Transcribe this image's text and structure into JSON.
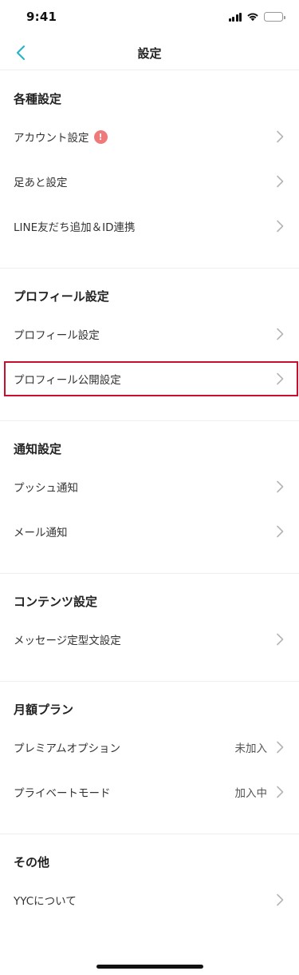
{
  "status": {
    "time": "9:41"
  },
  "nav": {
    "title": "設定"
  },
  "sections": [
    {
      "title": "各種設定",
      "items": [
        {
          "label": "アカウント設定",
          "alert": "!"
        },
        {
          "label": "足あと設定"
        },
        {
          "label": "LINE友だち追加＆ID連携"
        }
      ]
    },
    {
      "title": "プロフィール設定",
      "items": [
        {
          "label": "プロフィール設定"
        },
        {
          "label": "プロフィール公開設定"
        }
      ]
    },
    {
      "title": "通知設定",
      "items": [
        {
          "label": "プッシュ通知"
        },
        {
          "label": "メール通知"
        }
      ]
    },
    {
      "title": "コンテンツ設定",
      "items": [
        {
          "label": "メッセージ定型文設定"
        }
      ]
    },
    {
      "title": "月額プラン",
      "items": [
        {
          "label": "プレミアムオプション",
          "value": "未加入"
        },
        {
          "label": "プライベートモード",
          "value": "加入中"
        }
      ]
    },
    {
      "title": "その他",
      "items": [
        {
          "label": "YYCについて"
        }
      ]
    }
  ],
  "colors": {
    "accent": "#2bb3c9",
    "highlight_border": "#c8102e",
    "alert": "#f07a7a"
  },
  "icons": {
    "back": "chevron-left-icon",
    "row": "chevron-right-icon",
    "alert": "exclamation-icon"
  }
}
